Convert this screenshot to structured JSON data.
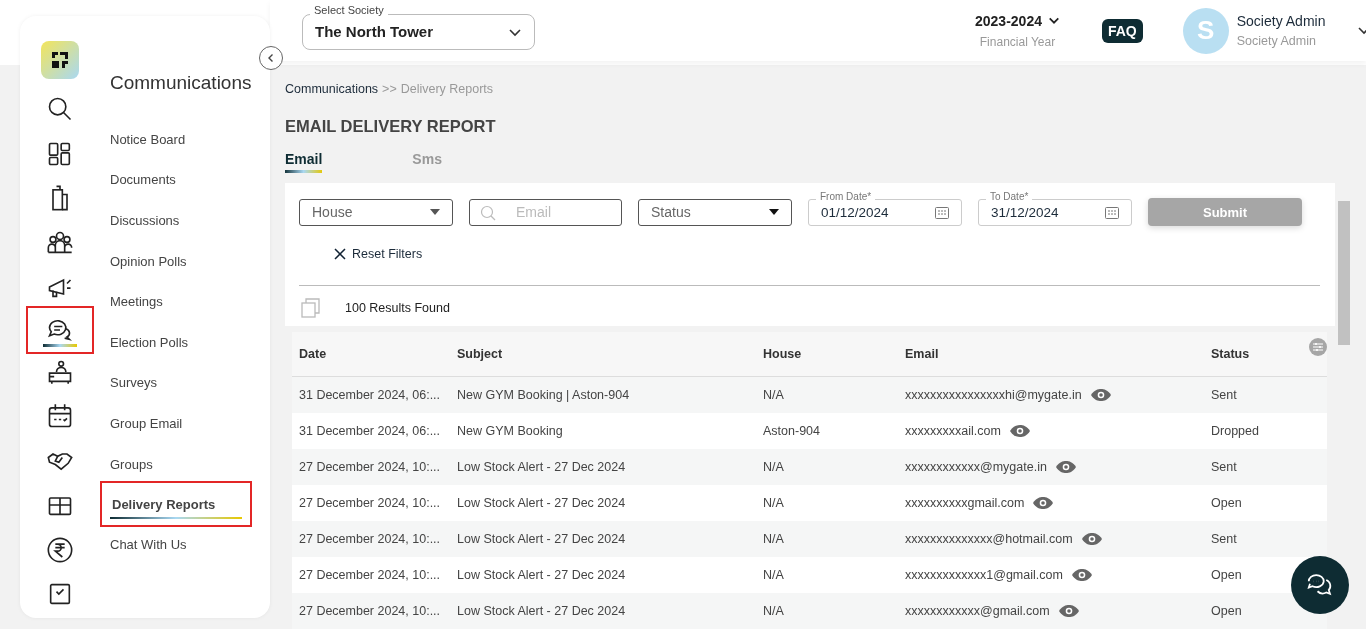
{
  "rail": [
    {
      "selected": false
    },
    {
      "selected": false
    },
    {
      "selected": false
    },
    {
      "selected": false
    },
    {
      "selected": false
    },
    {
      "selected": true
    },
    {
      "selected": false
    },
    {
      "selected": false
    },
    {
      "selected": false
    },
    {
      "selected": false
    },
    {
      "selected": false
    },
    {
      "selected": false
    }
  ],
  "menu": {
    "title": "Communications",
    "items": [
      {
        "label": "Notice Board",
        "selected": false
      },
      {
        "label": "Documents",
        "selected": false
      },
      {
        "label": "Discussions",
        "selected": false
      },
      {
        "label": "Opinion Polls",
        "selected": false
      },
      {
        "label": "Meetings",
        "selected": false
      },
      {
        "label": "Election Polls",
        "selected": false
      },
      {
        "label": "Surveys",
        "selected": false
      },
      {
        "label": "Group Email",
        "selected": false
      },
      {
        "label": "Groups",
        "selected": false
      },
      {
        "label": "Delivery Reports",
        "selected": true
      },
      {
        "label": "Chat With Us",
        "selected": false
      }
    ]
  },
  "header": {
    "society_label": "Select Society",
    "society": "The North Tower",
    "year": "2023-2024",
    "year_label": "Financial Year",
    "faq": "FAQ",
    "avatar_letter": "S",
    "user_name": "Society Admin",
    "user_role": "Society Admin"
  },
  "breadcrumb": {
    "parent": "Communications",
    "separator": ">>",
    "current": "Delivery Reports"
  },
  "page_title": "EMAIL DELIVERY REPORT",
  "tabs": [
    {
      "label": "Email",
      "selected": true
    },
    {
      "label": "Sms",
      "selected": false
    }
  ],
  "filters": {
    "house_placeholder": "House",
    "email_placeholder": "Email",
    "status_placeholder": "Status",
    "from_label": "From Date*",
    "from_value": "01/12/2024",
    "to_label": "To Date*",
    "to_value": "31/12/2024",
    "submit": "Submit",
    "submit_disabled": true,
    "reset": "Reset Filters"
  },
  "results": "100 Results Found",
  "table": {
    "columns": [
      "Date",
      "Subject",
      "House",
      "Email",
      "Status"
    ],
    "rows": [
      {
        "date": "31 December 2024, 06:...",
        "subject": "New GYM Booking | Aston-904",
        "house": "N/A",
        "email": "xxxxxxxxxxxxxxxxhi@mygate.in",
        "status": "Sent"
      },
      {
        "date": "31 December 2024, 06:...",
        "subject": "New GYM Booking",
        "house": "Aston-904",
        "email": "xxxxxxxxxail.com",
        "status": "Dropped"
      },
      {
        "date": "27 December 2024, 10:...",
        "subject": "Low Stock Alert - 27 Dec 2024",
        "house": "N/A",
        "email": "xxxxxxxxxxxx@mygate.in",
        "status": "Sent"
      },
      {
        "date": "27 December 2024, 10:...",
        "subject": "Low Stock Alert - 27 Dec 2024",
        "house": "N/A",
        "email": "xxxxxxxxxxgmail.com",
        "status": "Open"
      },
      {
        "date": "27 December 2024, 10:...",
        "subject": "Low Stock Alert - 27 Dec 2024",
        "house": "N/A",
        "email": "xxxxxxxxxxxxxx@hotmail.com",
        "status": "Sent"
      },
      {
        "date": "27 December 2024, 10:...",
        "subject": "Low Stock Alert - 27 Dec 2024",
        "house": "N/A",
        "email": "xxxxxxxxxxxxx1@gmail.com",
        "status": "Open"
      },
      {
        "date": "27 December 2024, 10:...",
        "subject": "Low Stock Alert - 27 Dec 2024",
        "house": "N/A",
        "email": "xxxxxxxxxxxx@gmail.com",
        "status": "Open"
      }
    ]
  }
}
